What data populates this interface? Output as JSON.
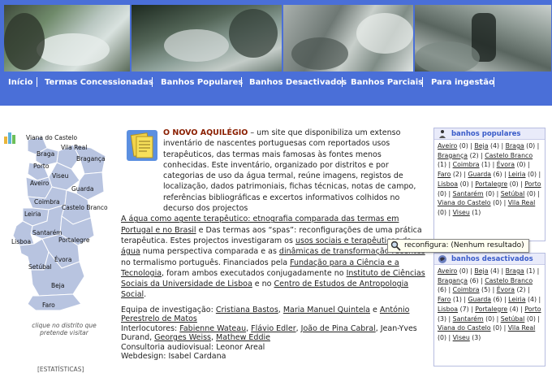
{
  "nav": [
    {
      "label": "Início"
    },
    {
      "label": "Termas Concessionadas"
    },
    {
      "label": "Banhos Populares"
    },
    {
      "label": "Banhos Desactivados"
    },
    {
      "label": "Banhos Parciais"
    },
    {
      "label": "Para ingestão"
    }
  ],
  "map": {
    "cities": [
      "Viana do Castelo",
      "Braga",
      "Vila Real",
      "Bragança",
      "Porto",
      "Aveiro",
      "Viseu",
      "Guarda",
      "Coimbra",
      "Leiria",
      "Castelo Branco",
      "Santarém",
      "Lisboa",
      "Portalegre",
      "Évora",
      "Setúbal",
      "Beja",
      "Faro"
    ],
    "caption": "clique no distrito que pretende visitar",
    "stats_label": "[ESTATÍSTICAS]",
    "fill_color": "#b8c4e0",
    "stroke_color": "#ffffff"
  },
  "main": {
    "title": "O NOVO AQUILÉGIO",
    "p1": " – um site que disponibiliza um extenso inventário de nascentes portuguesas com reportados usos terapêuticos, das termas mais famosas às fontes menos conhecidas. Este inventário, organizado por distritos e por categorias de uso da água termal, reúne imagens, registos de localização, dados patrimoniais, fichas técnicas, notas de campo, referências bibliográficas e excertos informativos colhidos no decurso dos projectos ",
    "link1": "A água como agente terapêutico: etnografia comparada das termas em Portugal e no Brasil",
    "p2": " e Das termas aos “spas”: reconfigurações de uma prática terapêutica. Estes projectos investigaram os ",
    "link2": "usos sociais e terapêuticos da água",
    "p3": " numa perspectiva comparada e as ",
    "link3": "dinâmicas de transformação recentes",
    "p4": " no termalismo português. Financiados pela ",
    "link4": "Fundação para a Ciência e a Tecnologia",
    "p5": ", foram ambos executados conjugadamente no ",
    "link5": "Instituto de Ciências Sociais da Universidade de Lisboa",
    "p6": " e no ",
    "link6": "Centro de Estudos de Antropologia Social",
    "p7": ".",
    "team_label": "Equipa de investigação: ",
    "team1": "Cristiana Bastos",
    "team_sep1": ", ",
    "team2": "Maria Manuel Quintela",
    "team_sep2": " e ",
    "team3": "António Perestrelo de Matos",
    "interloc_label": "Interlocutores: ",
    "inter1": "Fabienne Wateau",
    "inter2": "Flávio Edler",
    "inter3": "João de Pina Cabral",
    "inter_mid": ", Jean-Yves Durand, ",
    "inter4": "Georges Weiss",
    "inter5": "Mathew Eddie",
    "comma": ", ",
    "consult": "Consultoria audiovisual: Leonor Areal",
    "webdesign": "Webdesign: Isabel Cardana"
  },
  "boxes": [
    {
      "title": "banhos populares",
      "entries": [
        {
          "name": "Aveiro",
          "count": "(0)"
        },
        {
          "name": "Beja",
          "count": "(4)"
        },
        {
          "name": "Braga",
          "count": "(0)"
        },
        {
          "name": "Bragança",
          "count": "(2)"
        },
        {
          "name": "Castelo Branco",
          "count": "(1)"
        },
        {
          "name": "Coimbra",
          "count": "(1)"
        },
        {
          "name": "Évora",
          "count": "(0)"
        },
        {
          "name": "Faro",
          "count": "(2)"
        },
        {
          "name": "Guarda",
          "count": "(6)"
        },
        {
          "name": "Leiria",
          "count": "(0)"
        },
        {
          "name": "Lisboa",
          "count": "(0)"
        },
        {
          "name": "Portalegre",
          "count": "(0)"
        },
        {
          "name": "Porto",
          "count": "(0)"
        },
        {
          "name": "Santarém",
          "count": "(0)"
        },
        {
          "name": "Setúbal",
          "count": "(0)"
        },
        {
          "name": "Viana do Castelo",
          "count": "(0)"
        },
        {
          "name": "Vila Real",
          "count": "(0)"
        },
        {
          "name": "Viseu",
          "count": "(1)"
        }
      ]
    },
    {
      "title": "banhos desactivados",
      "entries": [
        {
          "name": "Aveiro",
          "count": "(0)"
        },
        {
          "name": "Beja",
          "count": "(4)"
        },
        {
          "name": "Braga",
          "count": "(1)"
        },
        {
          "name": "Bragança",
          "count": "(6)"
        },
        {
          "name": "Castelo Branco",
          "count": "(6)"
        },
        {
          "name": "Coimbra",
          "count": "(5)"
        },
        {
          "name": "Évora",
          "count": "(2)"
        },
        {
          "name": "Faro",
          "count": "(1)"
        },
        {
          "name": "Guarda",
          "count": "(6)"
        },
        {
          "name": "Leiria",
          "count": "(4)"
        },
        {
          "name": "Lisboa",
          "count": "(7)"
        },
        {
          "name": "Portalegre",
          "count": "(4)"
        },
        {
          "name": "Porto",
          "count": "(3)"
        },
        {
          "name": "Santarém",
          "count": "(0)"
        },
        {
          "name": "Setúbal",
          "count": "(0)"
        },
        {
          "name": "Viana do Castelo",
          "count": "(0)"
        },
        {
          "name": "Vila Real",
          "count": "(0)"
        },
        {
          "name": "Viseu",
          "count": "(3)"
        }
      ]
    }
  ],
  "tooltip": {
    "text": "reconfigura: (Nenhum resultado)"
  },
  "colors": {
    "nav_bg": "#4a6fd8",
    "box_title": "#3a5cc9",
    "title_accent": "#8a1e00"
  }
}
